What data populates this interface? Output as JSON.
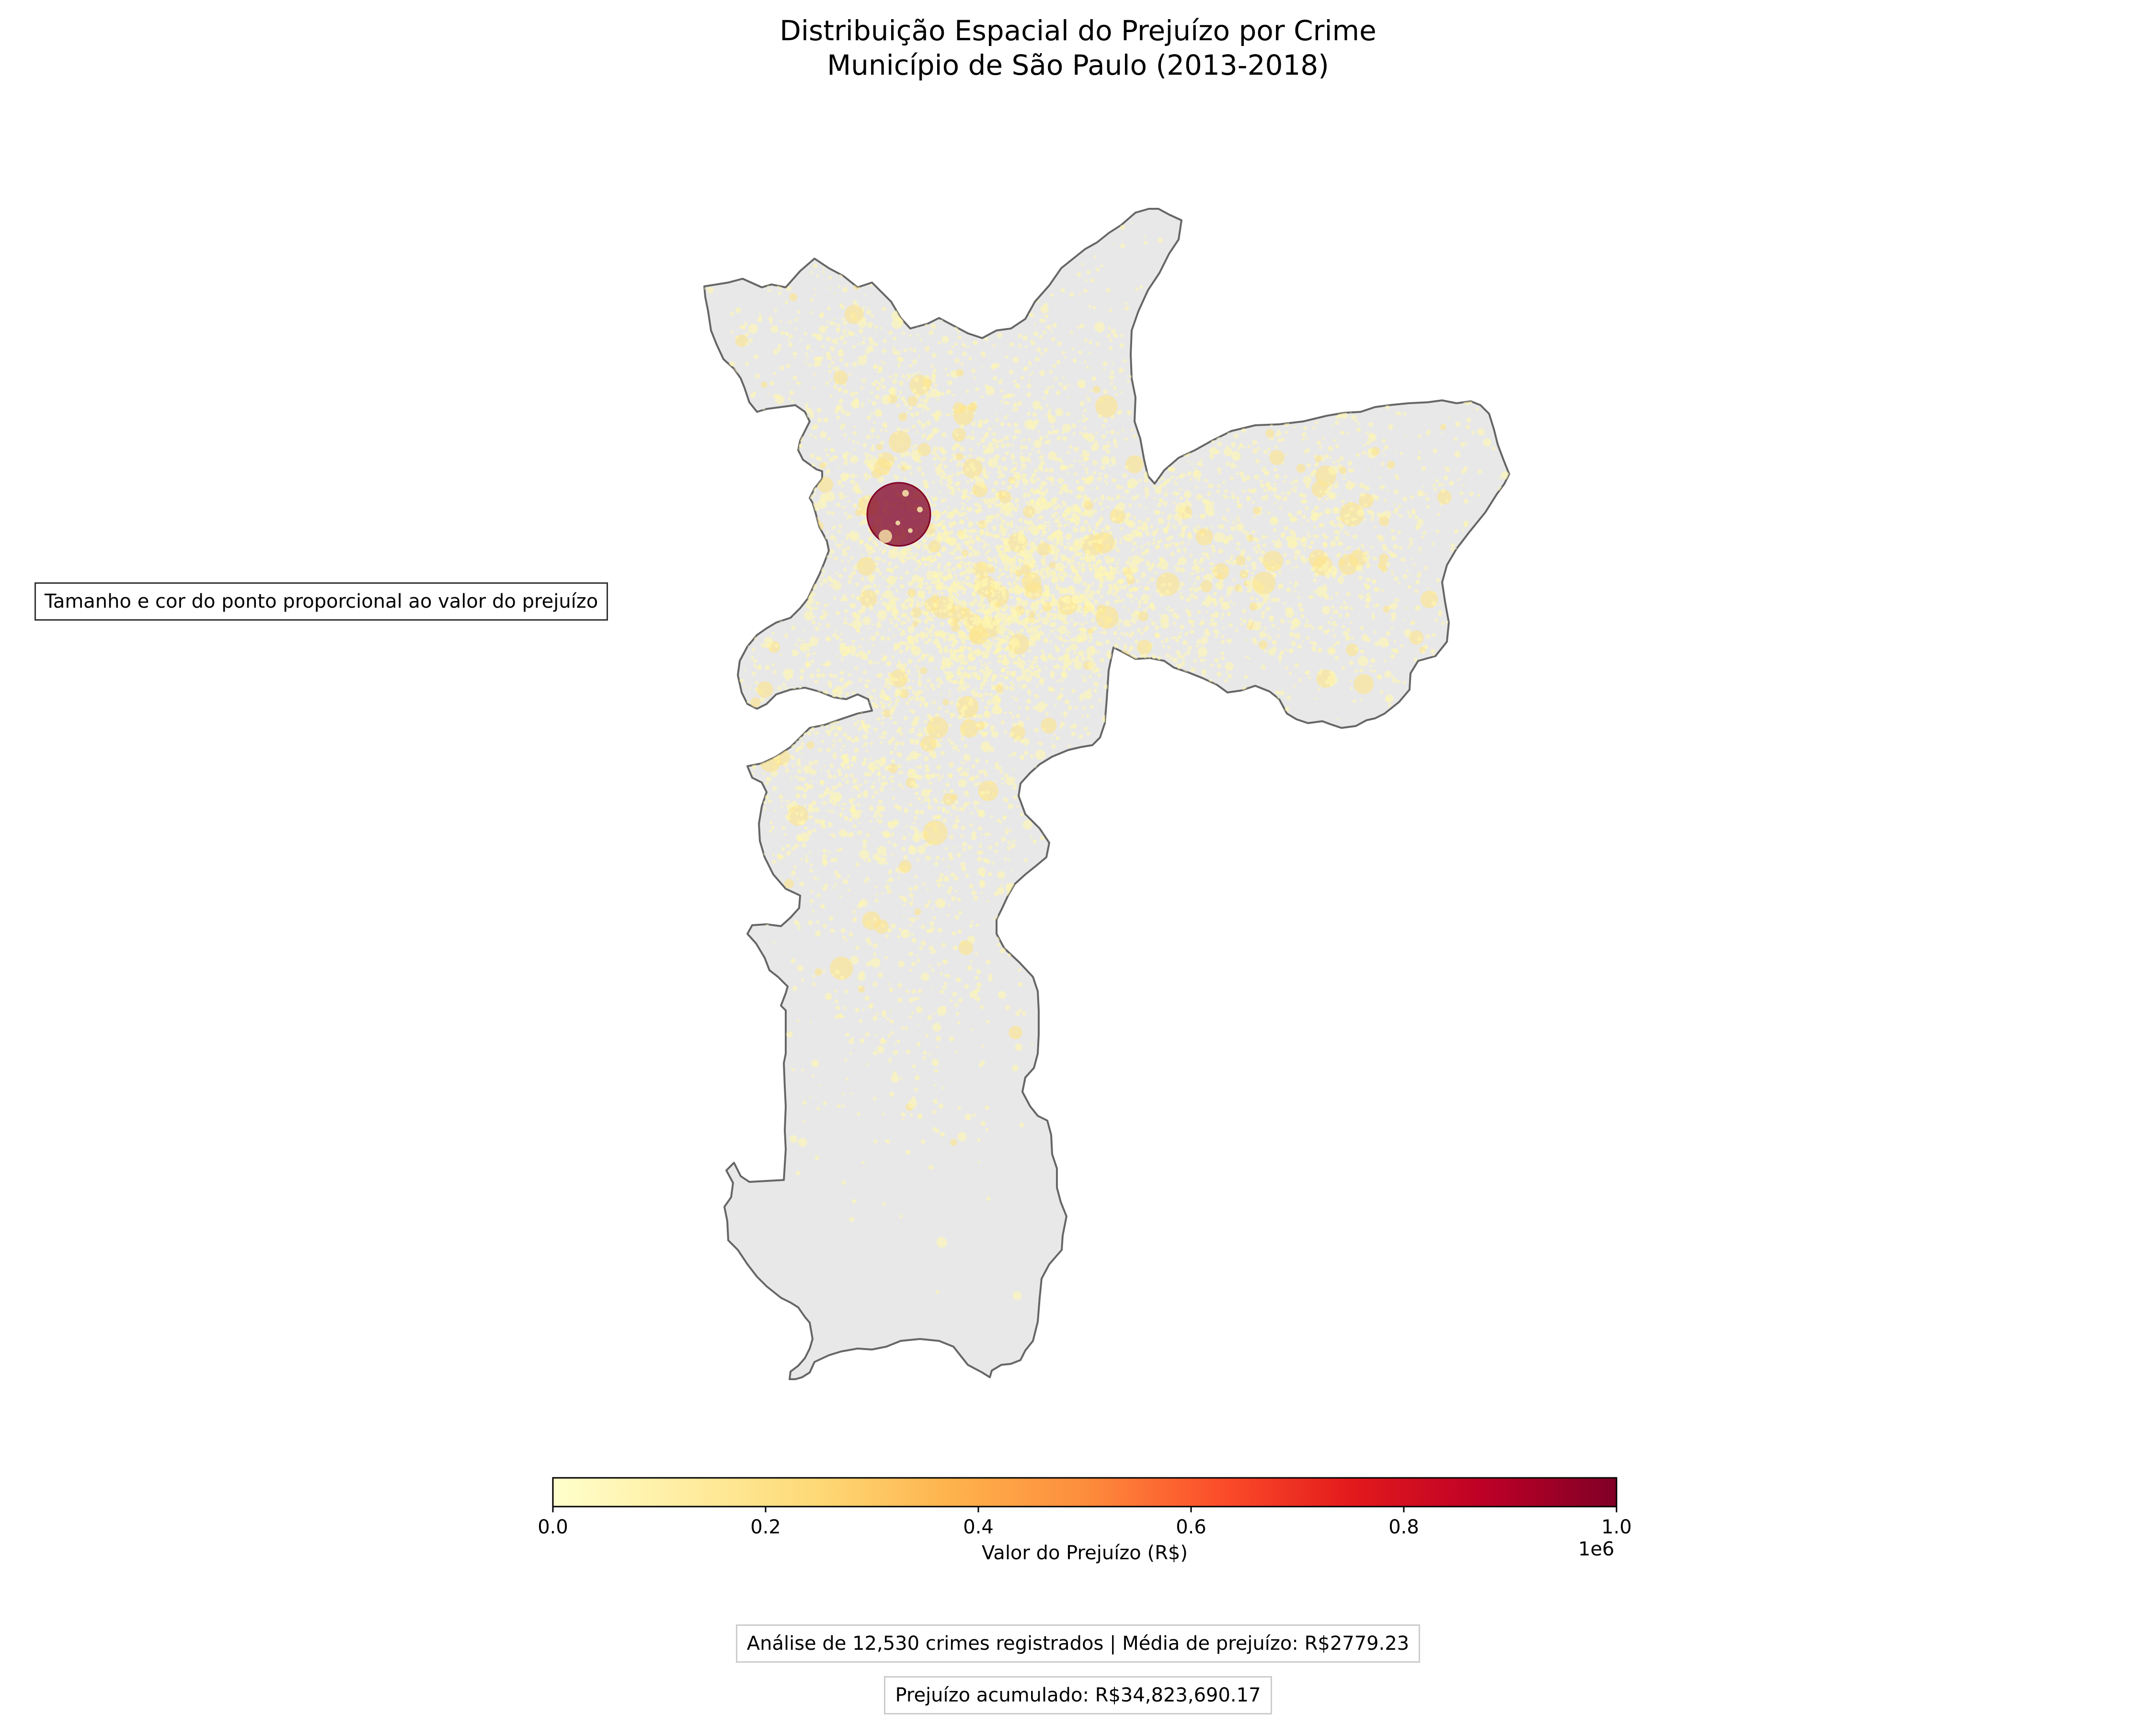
{
  "title": {
    "line1": "Distribuição Espacial do Prejuízo por Crime",
    "line2": "Município de São Paulo (2013-2018)"
  },
  "annotation": "Tamanho e cor do ponto proporcional ao valor do prejuízo",
  "colorbar": {
    "label": "Valor do Prejuízo (R$)",
    "ticks": [
      "0.0",
      "0.2",
      "0.4",
      "0.6",
      "0.8",
      "1.0"
    ],
    "exponent": "1e6",
    "min": 0,
    "max": 1000000,
    "colormap": "YlOrRd",
    "colors": [
      "#ffffcc",
      "#ffeda0",
      "#fed976",
      "#feb24c",
      "#fd8d3c",
      "#fc4e2a",
      "#e31a1c",
      "#bd0026",
      "#800026"
    ]
  },
  "stats": {
    "line1": "Análise de 12,530 crimes registrados | Média de prejuízo: R$2779.23",
    "line2": "Prejuízo acumulado: R$34,823,690.17"
  },
  "map": {
    "region_fill": "#e8e8e8",
    "region_stroke": "#666666",
    "point_color_low": "#fff7bc",
    "point_color_high": "#800026"
  }
}
